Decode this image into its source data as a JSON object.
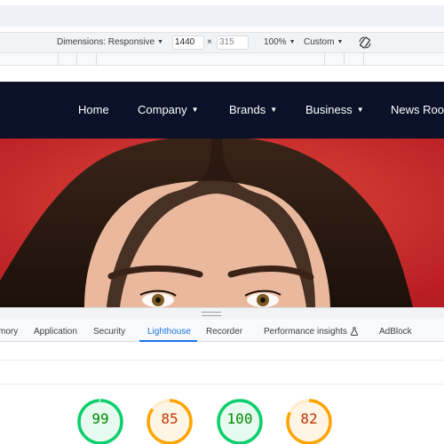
{
  "device_toolbar": {
    "dimensions_label": "Dimensions: Responsive",
    "width": "1440",
    "height": "315",
    "zoom": "100%",
    "throttle": "Custom"
  },
  "site_nav": {
    "items": [
      {
        "label": "Home",
        "has_dropdown": false
      },
      {
        "label": "Company",
        "has_dropdown": true
      },
      {
        "label": "Brands",
        "has_dropdown": true
      },
      {
        "label": "Business",
        "has_dropdown": true
      },
      {
        "label": "News Room",
        "has_dropdown": false
      }
    ]
  },
  "devtools": {
    "tabs": [
      {
        "label": "mory"
      },
      {
        "label": "Application"
      },
      {
        "label": "Security"
      },
      {
        "label": "Lighthouse",
        "active": true
      },
      {
        "label": "Recorder"
      },
      {
        "label": "Performance insights"
      },
      {
        "label": "AdBlock"
      }
    ]
  },
  "lighthouse": {
    "scores": [
      {
        "value": "99",
        "score": 99,
        "status": "pass"
      },
      {
        "value": "85",
        "score": 85,
        "status": "average"
      },
      {
        "value": "100",
        "score": 100,
        "status": "pass"
      },
      {
        "value": "82",
        "score": 82,
        "status": "average"
      }
    ]
  },
  "colors": {
    "nav_bg": "#0a1128",
    "hero_red": "#c8262b",
    "accent_blue": "#1a73e8",
    "score_pass": "#0cce6b",
    "score_pass_text": "#008800",
    "score_pass_bg": "#e6faef",
    "score_average": "#ffa400",
    "score_average_text": "#c33300",
    "score_average_bg": "#fff5e5"
  }
}
